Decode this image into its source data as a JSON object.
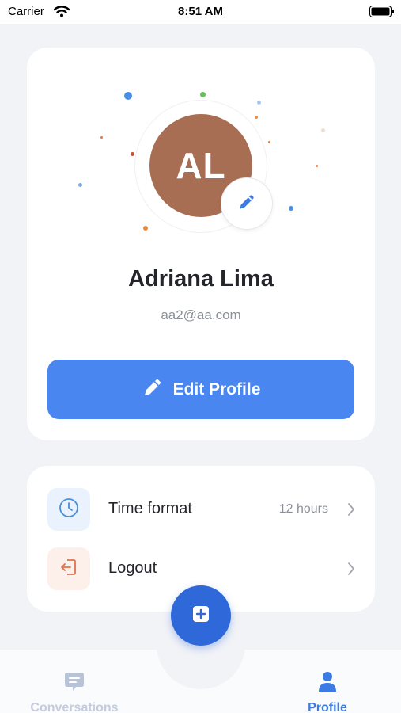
{
  "status_bar": {
    "carrier": "Carrier",
    "time": "8:51 AM"
  },
  "profile": {
    "initials": "AL",
    "name": "Adriana Lima",
    "email": "aa2@aa.com",
    "avatar_color": "#a86e53",
    "edit_button_label": "Edit Profile",
    "accent_color": "#4a86f0"
  },
  "settings": {
    "items": [
      {
        "label": "Time format",
        "value": "12 hours",
        "icon": "clock-icon",
        "icon_color": "#4a90d9"
      },
      {
        "label": "Logout",
        "icon": "logout-icon",
        "icon_color": "#e0714e"
      }
    ]
  },
  "tab_bar": {
    "tabs": [
      {
        "label": "Conversations",
        "icon": "chat-bubble-icon",
        "active": false
      },
      {
        "label": "Profile",
        "icon": "person-icon",
        "active": true
      }
    ],
    "fab_icon": "new-chat-icon",
    "active_color": "#3c7be4",
    "inactive_color": "#b9c3d8"
  }
}
